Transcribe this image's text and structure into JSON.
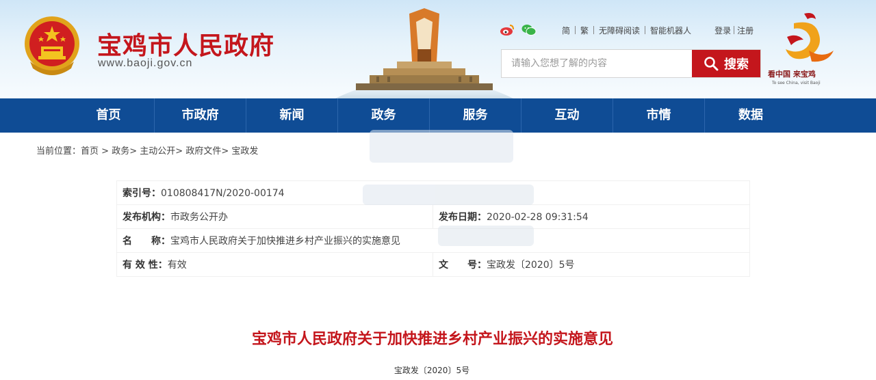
{
  "header": {
    "site_title": "宝鸡市人民政府",
    "site_url": "www.baoji.gov.cn",
    "toplinks": {
      "simplified": "简",
      "traditional": "繁",
      "accessible": "无障碍阅读",
      "robot": "智能机器人",
      "login": "登录",
      "register": "注册"
    },
    "search": {
      "placeholder": "请输入您想了解的内容",
      "button_label": "搜索"
    },
    "city_logo": {
      "slogan": "看中国 来宝鸡",
      "slogan_en": "To see China, visit Baoji"
    },
    "icons": [
      "weibo-icon",
      "wechat-icon",
      "search-icon"
    ],
    "colors": {
      "brand_red": "#c4161c",
      "nav_blue": "#0f4c95"
    }
  },
  "nav": {
    "items": [
      "首页",
      "市政府",
      "新闻",
      "政务",
      "服务",
      "互动",
      "市情",
      "数据"
    ]
  },
  "breadcrumb": {
    "prefix": "当前位置：",
    "items": [
      "首页",
      "政务",
      "主动公开",
      "政府文件",
      "宝政发"
    ],
    "separator": ">"
  },
  "meta": {
    "index_label": "索引号：",
    "index_value": "010808417N/2020-00174",
    "org_label": "发布机构：",
    "org_value": "市政务公开办",
    "date_label": "发布日期：",
    "date_value": "2020-02-28 09:31:54",
    "name_label": "名　　称：",
    "name_value": "宝鸡市人民政府关于加快推进乡村产业振兴的实施意见",
    "validity_label": "有 效 性：",
    "validity_value": "有效",
    "docno_label": "文　　号：",
    "docno_value": "宝政发〔2020〕5号"
  },
  "article": {
    "title": "宝鸡市人民政府关于加快推进乡村产业振兴的实施意见",
    "doc_number": "宝政发〔2020〕5号"
  }
}
